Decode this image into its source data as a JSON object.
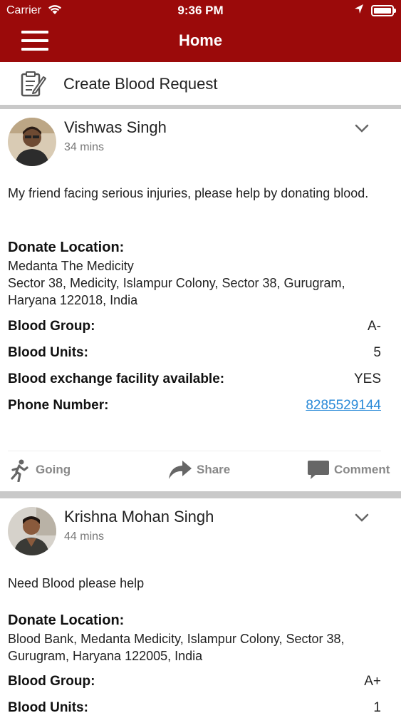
{
  "status_bar": {
    "carrier": "Carrier",
    "time": "9:36 PM"
  },
  "nav": {
    "title": "Home"
  },
  "create_request": {
    "label": "Create Blood Request"
  },
  "labels": {
    "donate_location": "Donate Location:",
    "blood_group": "Blood Group:",
    "blood_units": "Blood Units:",
    "exchange": "Blood exchange facility available:",
    "phone": "Phone Number:"
  },
  "actions": {
    "going": "Going",
    "share": "Share",
    "comment": "Comment"
  },
  "posts": [
    {
      "name": "Vishwas Singh",
      "time": "34 mins",
      "message": "My friend facing serious injuries, please help by donating blood.",
      "location": "Medanta The Medicity\nSector 38, Medicity, Islampur Colony, Sector 38, Gurugram, Haryana 122018, India",
      "blood_group": "A-",
      "blood_units": "5",
      "exchange": "YES",
      "phone": "8285529144"
    },
    {
      "name": "Krishna Mohan Singh",
      "time": "44 mins",
      "message": "Need Blood please help",
      "location": "Blood Bank, Medanta Medicity, Islampur Colony, Sector 38, Gurugram, Haryana 122005, India",
      "blood_group": "A+",
      "blood_units": "1"
    }
  ],
  "colors": {
    "brand": "#9b0a0a",
    "link": "#2a8ad8",
    "divider": "#c9c9c9"
  }
}
